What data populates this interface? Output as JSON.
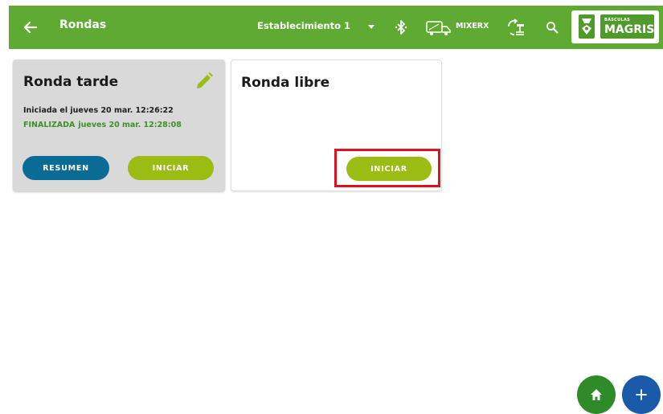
{
  "appbar": {
    "title": "Rondas",
    "establishment": "Establecimiento 1",
    "mixer_label": "MIXERX",
    "logo_small": "BÁSCULAS",
    "logo_big": "MAGRIS",
    "icons": [
      "back-arrow-icon",
      "dropdown-caret-icon",
      "bluetooth-icon",
      "mixer-truck-icon",
      "sync-scale-icon",
      "search-icon"
    ],
    "colors": {
      "bar": "#5faa33",
      "logo_green": "#4f9a2a"
    }
  },
  "cards": [
    {
      "title": "Ronda tarde",
      "started": "Iniciada el jueves 20 mar. 12:26:22",
      "status": "FINALIZADA",
      "finished_date": "jueves 20 mar. 12:28:08",
      "summary_label": "RESUMEN",
      "start_label": "INICIAR",
      "icon": "edit-pencil-icon"
    },
    {
      "title": "Ronda libre",
      "start_label": "INICIAR"
    }
  ],
  "fabs": {
    "home_icon": "home-icon",
    "add_icon": "plus-icon"
  },
  "colors": {
    "summary": "#0b6b97",
    "start": "#9bbc12",
    "highlight": "#e0101e",
    "home": "#2f8a2a",
    "add": "#1a5aa8"
  }
}
